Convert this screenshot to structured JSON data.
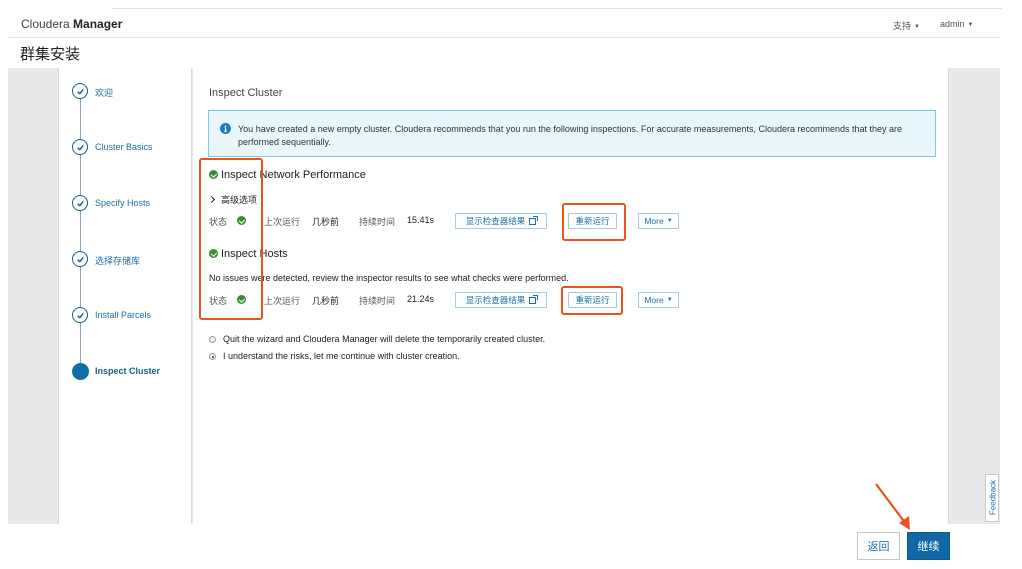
{
  "header": {
    "brand_light": "Cloudera",
    "brand_bold": "Manager",
    "support_label": "支持",
    "user_label": "admin"
  },
  "page": {
    "title": "群集安装"
  },
  "steps": [
    {
      "label": "欢迎",
      "done": true
    },
    {
      "label": "Cluster Basics",
      "done": true
    },
    {
      "label": "Specify Hosts",
      "done": true
    },
    {
      "label": "选择存储库",
      "done": true
    },
    {
      "label": "Install Parcels",
      "done": true
    },
    {
      "label": "Inspect Cluster",
      "active": true
    }
  ],
  "main": {
    "section_title": "Inspect Cluster",
    "alert": "You have created a new empty cluster. Cloudera recommends that you run the following inspections. For accurate measurements, Cloudera recommends that they are performed sequentially.",
    "network": {
      "title": "Inspect Network Performance",
      "advanced_label": "高级选项",
      "status_label": "状态",
      "last_run_label": "上次运行",
      "last_run_value": "几秒前",
      "duration_label": "持续时间",
      "duration_value": "15.41s",
      "show_results_label": "显示检查器结果",
      "rerun_label": "重新运行",
      "more_label": "More"
    },
    "hosts": {
      "title": "Inspect Hosts",
      "note": "No issues were detected, review the inspector results to see what checks were performed.",
      "status_label": "状态",
      "last_run_label": "上次运行",
      "last_run_value": "几秒前",
      "duration_label": "持续时间",
      "duration_value": "21.24s",
      "show_results_label": "显示检查器结果",
      "rerun_label": "重新运行",
      "more_label": "More"
    },
    "options": [
      {
        "label": "Quit the wizard and Cloudera Manager will delete the temporarily created cluster.",
        "selected": false
      },
      {
        "label": "I understand the risks, let me continue with cluster creation.",
        "selected": true
      }
    ]
  },
  "feedback_label": "Feedback",
  "footer": {
    "back_label": "返回",
    "continue_label": "继续"
  },
  "colors": {
    "accent": "#0f67a3",
    "success": "#3a8e2f",
    "highlight": "#e8541e",
    "alert_bg": "#e9f6fb"
  }
}
